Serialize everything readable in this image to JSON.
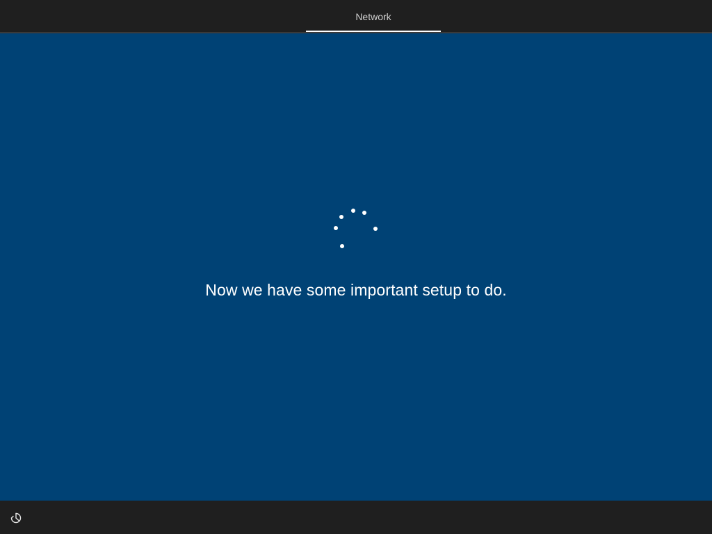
{
  "header": {
    "active_step_label": "Network"
  },
  "main": {
    "status_message": "Now we have some important setup to do.",
    "progress_indicator": "loading-spinner"
  },
  "footer": {
    "ease_of_access_icon": "ease-of-access-icon"
  },
  "colors": {
    "background_blue": "#004275",
    "chrome_dark": "#1f1f1f",
    "text_white": "#ffffff"
  }
}
